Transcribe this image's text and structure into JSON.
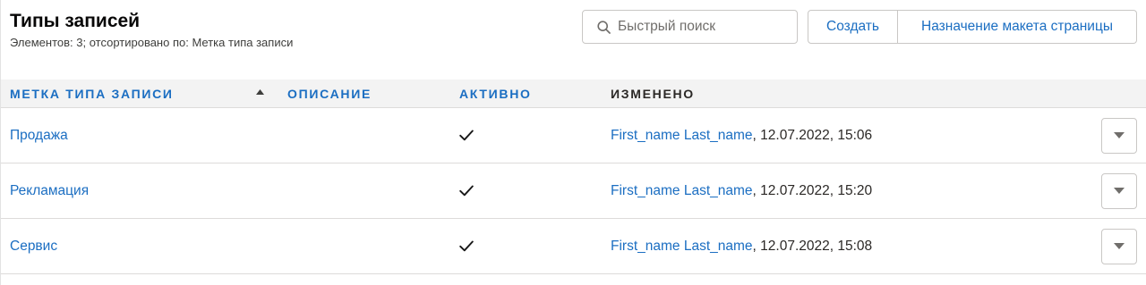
{
  "header": {
    "title": "Типы записей",
    "subtitle": "Элементов: 3; отсортировано по: Метка типа записи"
  },
  "search": {
    "placeholder": "Быстрый поиск",
    "value": "",
    "icon": "search-icon"
  },
  "toolbar": {
    "create_label": "Создать",
    "page_layout_label": "Назначение макета страницы"
  },
  "table": {
    "columns": [
      {
        "label": "МЕТКА ТИПА ЗАПИСИ",
        "sortable": true,
        "sorted": "ascending",
        "sort_icon": "arrow-up-icon"
      },
      {
        "label": "ОПИСАНИЕ",
        "sortable": true
      },
      {
        "label": "АКТИВНО",
        "sortable": true
      },
      {
        "label": "ИЗМЕНЕНО",
        "sortable": false
      }
    ],
    "modified_separator": ", ",
    "active_icon": "checkmark-icon",
    "row_action_icon": "chevron-down-icon",
    "rows": [
      {
        "label": "Продажа",
        "description": "",
        "active": true,
        "modified_by": "First_name Last_name",
        "modified_at": "12.07.2022, 15:06"
      },
      {
        "label": "Рекламация",
        "description": "",
        "active": true,
        "modified_by": "First_name Last_name",
        "modified_at": "12.07.2022, 15:20"
      },
      {
        "label": "Сервис",
        "description": "",
        "active": true,
        "modified_by": "First_name Last_name",
        "modified_at": "12.07.2022, 15:08"
      }
    ]
  },
  "colors": {
    "link": "#1b6ec2",
    "text": "#080707",
    "secondary_text": "#3e3e3c",
    "muted": "#706e6b",
    "header_background": "#f3f3f3",
    "border": "#dddbda",
    "control_border": "#c9c7c5"
  }
}
